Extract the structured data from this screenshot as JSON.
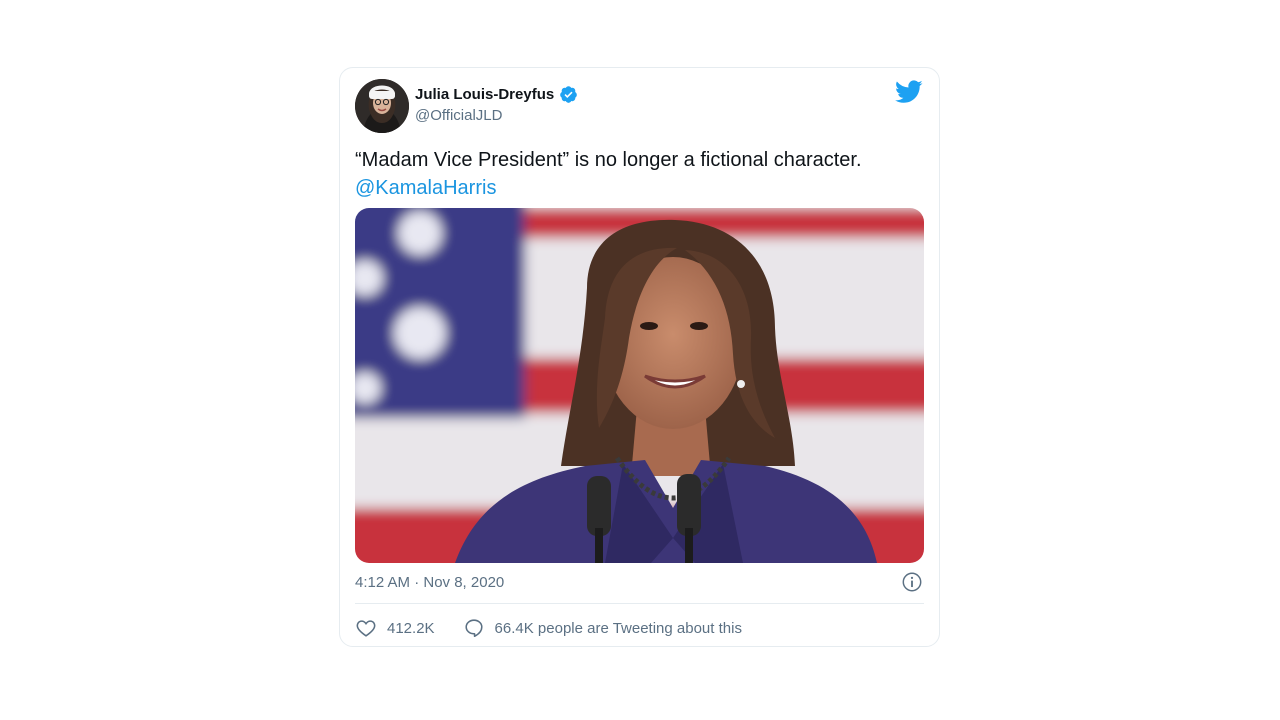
{
  "tweet": {
    "author": {
      "name": "Julia Louis-Dreyfus",
      "handle": "@OfficialJLD",
      "verified": true,
      "avatar_icon": "avatar"
    },
    "platform_icon": "twitter-bird-icon",
    "text": "“Madam Vice President” is no longer a fictional character.",
    "mention": "@KamalaHarris",
    "media_icon": "photo",
    "timestamp": "4:12 AM · Nov 8, 2020",
    "likes": "412.2K",
    "tweeting_count": "66.4K people are Tweeting about this"
  },
  "colors": {
    "accent": "#1da1f2",
    "link": "#1b95e0",
    "secondary_text": "#5b7083",
    "border": "#e6ecf0"
  }
}
